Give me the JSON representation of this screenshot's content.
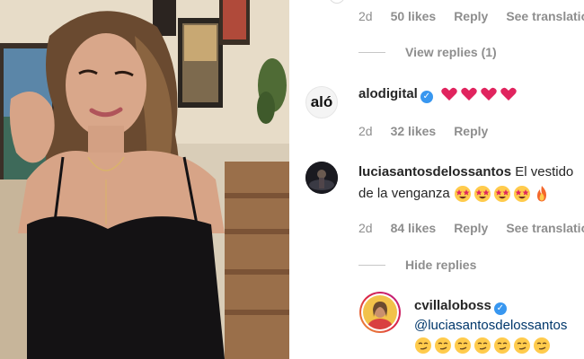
{
  "comments_panel": {
    "top_meta": {
      "time": "2d",
      "likes": "50 likes",
      "reply": "Reply",
      "translate": "See translation"
    },
    "view_replies_label": "View replies (1)",
    "comment1": {
      "username": "alodigital",
      "avatar_text": "aló",
      "emoji": [
        "red-heart",
        "red-heart",
        "red-heart",
        "red-heart"
      ],
      "meta": {
        "time": "2d",
        "likes": "32 likes",
        "reply": "Reply"
      }
    },
    "comment2": {
      "username": "luciasantosdelossantos",
      "text_line1": "El vestido",
      "text_line2": "de la venganza",
      "emoji": [
        "star-struck",
        "star-struck",
        "star-struck",
        "star-struck",
        "fire"
      ],
      "meta": {
        "time": "2d",
        "likes": "84 likes",
        "reply": "Reply",
        "translate": "See translation"
      }
    },
    "hide_replies_label": "Hide replies",
    "reply1": {
      "username": "cvillaloboss",
      "mention": "@luciasantosdelossantos",
      "emoji": [
        "smirk",
        "smirk",
        "smirk",
        "smirk",
        "smirk",
        "smirk",
        "smirk"
      ]
    }
  },
  "colors": {
    "verified": "#3897f0",
    "secondary_text": "#8e8e8e",
    "mention": "#00376b",
    "heart": "#e0245e",
    "story_ring": "#d6249f"
  }
}
